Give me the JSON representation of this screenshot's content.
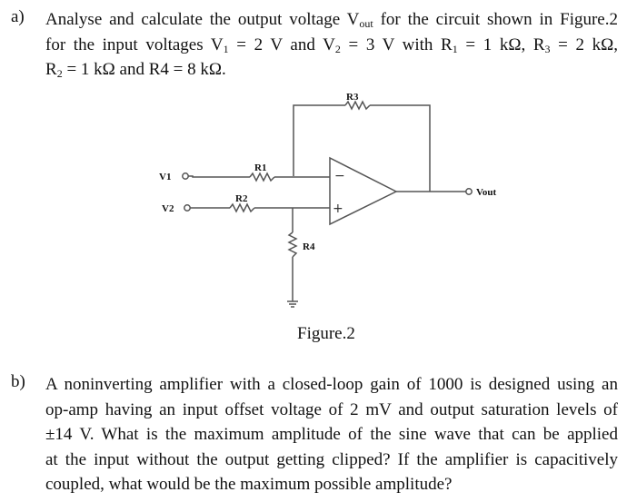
{
  "question_a": {
    "label": "a)",
    "line1": "Analyse and calculate the output voltage V",
    "line1_sub": "out",
    "line1_tail": " for the circuit shown in Figure.2",
    "line2_parts": [
      "for the input voltages V",
      "1",
      " = 2 V and V",
      "2",
      " = 3 V with R",
      "1",
      " = 1 kΩ, R",
      "3",
      " = 2 kΩ,"
    ],
    "line3_parts": [
      "R",
      "2",
      " = 1 kΩ and R4 = 8 kΩ."
    ]
  },
  "figure": {
    "caption": "Figure.2",
    "labels": {
      "v1": "V1",
      "v2": "V2",
      "r1": "R1",
      "r2": "R2",
      "r3": "R3",
      "r4": "R4",
      "vout": "Vout",
      "minus": "−",
      "plus": "+"
    },
    "values": {
      "V1": "2 V",
      "V2": "3 V",
      "R1": "1 kΩ",
      "R2": "1 kΩ",
      "R3": "2 kΩ",
      "R4": "8 kΩ"
    }
  },
  "question_b": {
    "label": "b)",
    "lines": [
      "A noninverting amplifier with a closed-loop gain of 1000 is designed using an",
      "op-amp having an input offset voltage of 2 mV and output saturation levels of",
      "±14 V. What is the maximum amplitude of the sine wave that can be applied",
      "at the input without the output getting clipped? If the amplifier is capacitively",
      "coupled, what would be the maximum possible amplitude?"
    ]
  }
}
